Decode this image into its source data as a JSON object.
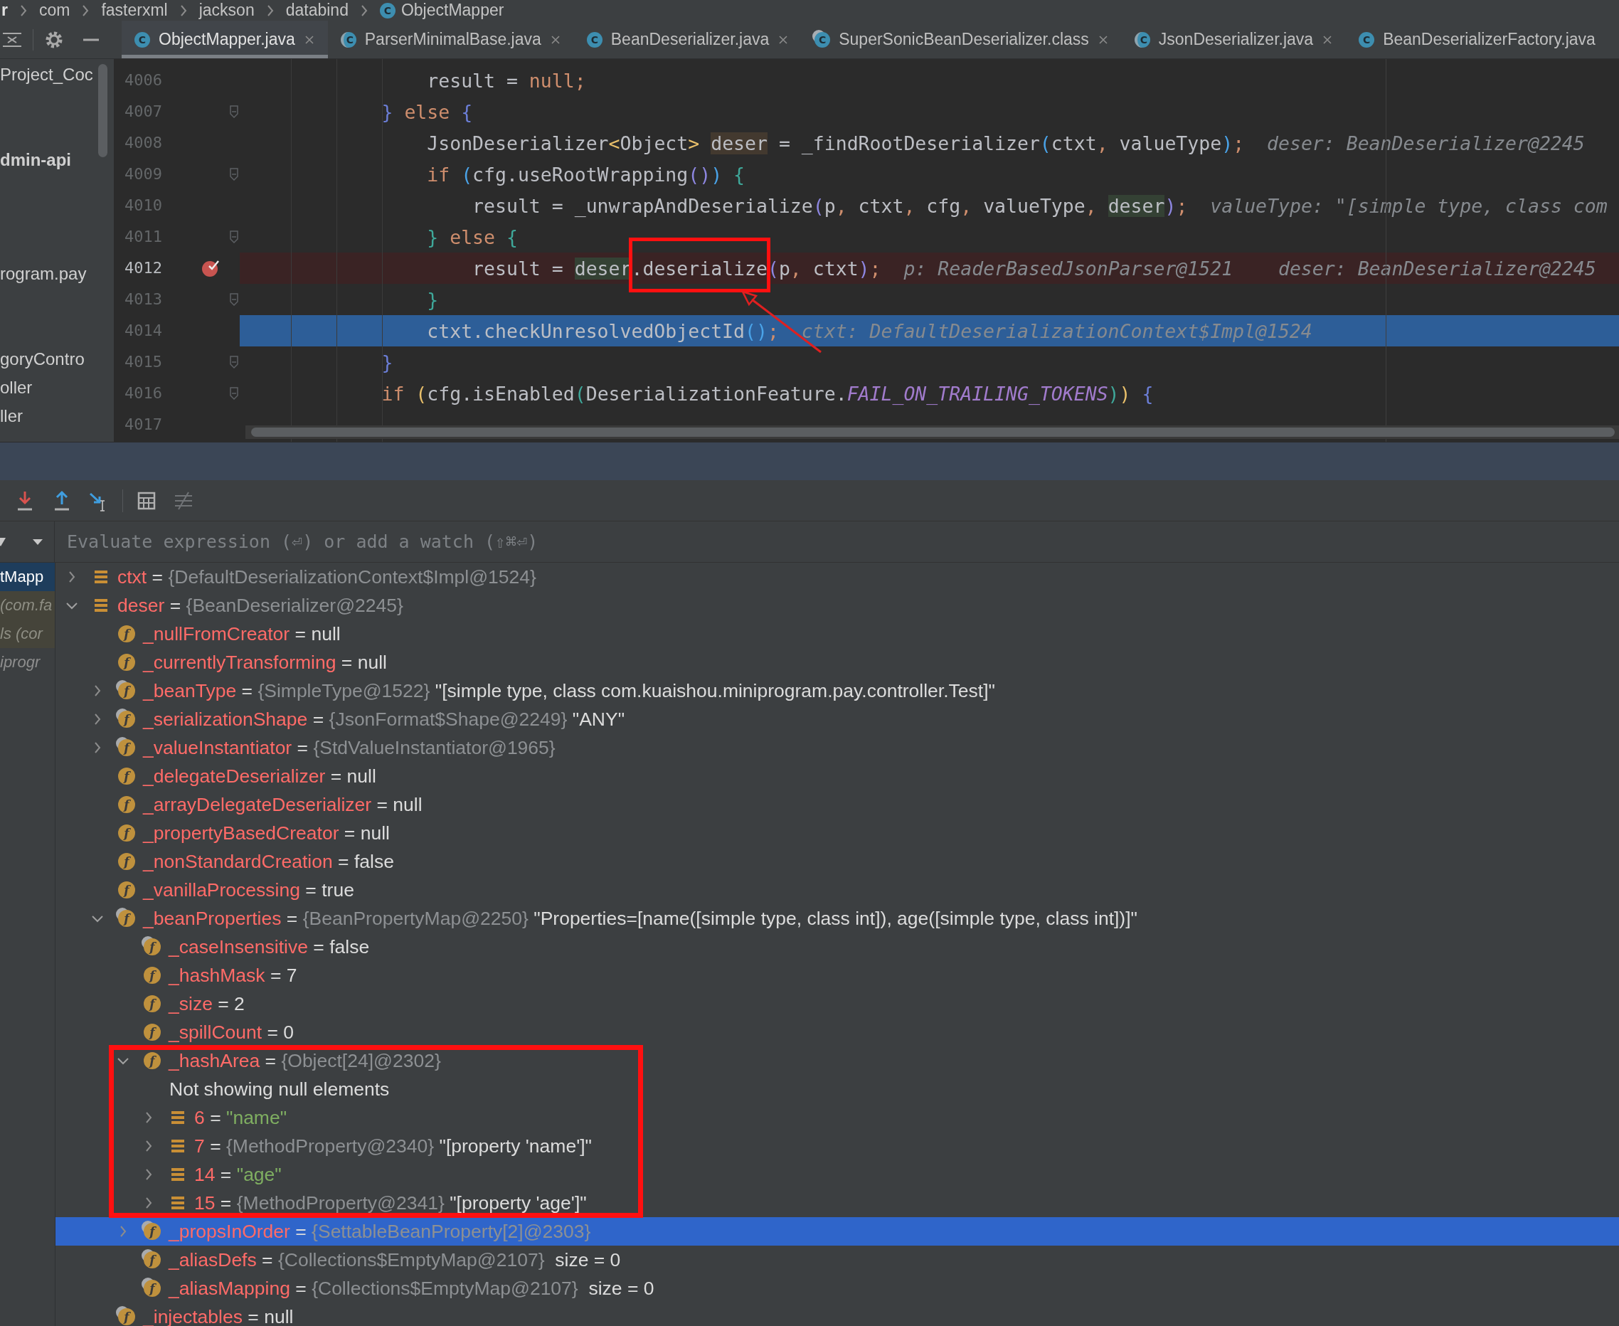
{
  "breadcrumbs": [
    {
      "text": "r"
    },
    {
      "text": "com"
    },
    {
      "text": "fasterxml"
    },
    {
      "text": "jackson"
    },
    {
      "text": "databind"
    },
    {
      "text": "ObjectMapper",
      "badge": "C"
    }
  ],
  "tabs": [
    {
      "label": "ObjectMapper.java",
      "kind": "class",
      "badge": "C",
      "selected": true,
      "closable": true
    },
    {
      "label": "ParserMinimalBase.java",
      "kind": "abstract",
      "badge": "C",
      "selected": false,
      "closable": true
    },
    {
      "label": "BeanDeserializer.java",
      "kind": "class",
      "badge": "C",
      "selected": false,
      "closable": true
    },
    {
      "label": "SuperSonicBeanDeserializer.class",
      "kind": "compiled",
      "badge": "C",
      "selected": false,
      "closable": true
    },
    {
      "label": "JsonDeserializer.java",
      "kind": "abstract",
      "badge": "C",
      "selected": false,
      "closable": true
    },
    {
      "label": "BeanDeserializerFactory.java",
      "kind": "class",
      "badge": "C",
      "selected": false,
      "closable": false
    }
  ],
  "project_panel": {
    "items": [
      {
        "text": "Project_Coc",
        "bold": false
      },
      {
        "text": "dmin-api",
        "bold": true
      },
      {
        "text": "rogram.pay",
        "bold": false
      },
      {
        "text": "goryContro",
        "bold": false
      },
      {
        "text": "oller",
        "bold": false
      },
      {
        "text": "ller",
        "bold": false
      }
    ]
  },
  "editor": {
    "lines": [
      {
        "number": "4006",
        "kind": "normal",
        "fold": false,
        "code": [
          {
            "text": "                result = ",
            "kind": "plain"
          },
          {
            "text": "null",
            "kind": "keyword"
          },
          {
            "text": ";",
            "kind": "keyword"
          }
        ]
      },
      {
        "number": "4007",
        "kind": "normal",
        "fold": true,
        "code": [
          {
            "text": "            }",
            "kind": "brace-blue"
          },
          {
            "text": " else ",
            "kind": "keyword"
          },
          {
            "text": "{",
            "kind": "brace-blue"
          }
        ]
      },
      {
        "number": "4008",
        "kind": "normal",
        "fold": false,
        "code": [
          {
            "text": "                JsonDeserializer",
            "kind": "plain"
          },
          {
            "text": "<",
            "kind": "angle"
          },
          {
            "text": "Object",
            "kind": "plain"
          },
          {
            "text": "> ",
            "kind": "angle"
          },
          {
            "text": "deser",
            "kind": "declaration"
          },
          {
            "text": " = _findRootDeserializer",
            "kind": "plain"
          },
          {
            "text": "(",
            "kind": "paren-blue"
          },
          {
            "text": "ctxt",
            "kind": "plain"
          },
          {
            "text": ", ",
            "kind": "keyword"
          },
          {
            "text": "valueType",
            "kind": "plain"
          },
          {
            "text": ")",
            "kind": "paren-blue"
          },
          {
            "text": ";",
            "kind": "keyword"
          }
        ],
        "hints": [
          "deser: BeanDeserializer@2245"
        ]
      },
      {
        "number": "4009",
        "kind": "normal",
        "fold": true,
        "code": [
          {
            "text": "                if",
            "kind": "keyword"
          },
          {
            "text": " (",
            "kind": "paren-blue"
          },
          {
            "text": "cfg.useRootWrapping",
            "kind": "plain"
          },
          {
            "text": "()",
            "kind": "paren-purple"
          },
          {
            "text": ")",
            "kind": "paren-blue"
          },
          {
            "text": " {",
            "kind": "brace-green"
          }
        ]
      },
      {
        "number": "4010",
        "kind": "normal",
        "fold": false,
        "code": [
          {
            "text": "                    result = _unwrapAndDeserialize",
            "kind": "plain"
          },
          {
            "text": "(",
            "kind": "paren-purple"
          },
          {
            "text": "p",
            "kind": "plain"
          },
          {
            "text": ", ",
            "kind": "keyword"
          },
          {
            "text": "ctxt",
            "kind": "plain"
          },
          {
            "text": ", ",
            "kind": "keyword"
          },
          {
            "text": "cfg",
            "kind": "plain"
          },
          {
            "text": ", ",
            "kind": "keyword"
          },
          {
            "text": "valueType",
            "kind": "plain"
          },
          {
            "text": ", ",
            "kind": "keyword"
          },
          {
            "text": "deser",
            "kind": "usage"
          },
          {
            "text": ")",
            "kind": "paren-purple"
          },
          {
            "text": ";",
            "kind": "keyword"
          }
        ],
        "hints": [
          "valueType: \"[simple type, class com"
        ]
      },
      {
        "number": "4011",
        "kind": "normal",
        "fold": true,
        "code": [
          {
            "text": "                }",
            "kind": "brace-green"
          },
          {
            "text": " else ",
            "kind": "keyword"
          },
          {
            "text": "{",
            "kind": "brace-green"
          }
        ]
      },
      {
        "number": "4012",
        "kind": "breakpoint",
        "fold": false,
        "code": [
          {
            "text": "                    result = ",
            "kind": "plain"
          },
          {
            "text": "deser",
            "kind": "usage"
          },
          {
            "text": ".deserialize",
            "kind": "plain"
          },
          {
            "text": "(",
            "kind": "paren-purple"
          },
          {
            "text": "p",
            "kind": "plain"
          },
          {
            "text": ", ",
            "kind": "keyword"
          },
          {
            "text": "ctxt",
            "kind": "plain"
          },
          {
            "text": ")",
            "kind": "paren-purple"
          },
          {
            "text": ";",
            "kind": "keyword"
          }
        ],
        "hints": [
          "p: ReaderBasedJsonParser@1521",
          "deser: BeanDeserializer@2245"
        ]
      },
      {
        "number": "4013",
        "kind": "normal",
        "fold": true,
        "code": [
          {
            "text": "                }",
            "kind": "brace-green"
          }
        ]
      },
      {
        "number": "4014",
        "kind": "execution",
        "fold": false,
        "code": [
          {
            "text": "                ctxt.checkUnresolvedObjectId",
            "kind": "plain"
          },
          {
            "text": "()",
            "kind": "paren-blue"
          },
          {
            "text": ";",
            "kind": "keyword"
          }
        ],
        "hints": [
          "ctxt: DefaultDeserializationContext$Impl@1524"
        ]
      },
      {
        "number": "4015",
        "kind": "normal",
        "fold": true,
        "code": [
          {
            "text": "            }",
            "kind": "brace-blue"
          }
        ]
      },
      {
        "number": "4016",
        "kind": "normal",
        "fold": true,
        "code": [
          {
            "text": "            if",
            "kind": "keyword"
          },
          {
            "text": " (",
            "kind": "angle"
          },
          {
            "text": "cfg.isEnabled",
            "kind": "plain"
          },
          {
            "text": "(",
            "kind": "brace-green"
          },
          {
            "text": "DeserializationFeature.",
            "kind": "plain"
          },
          {
            "text": "FAIL_ON_TRAILING_TOKENS",
            "kind": "constant"
          },
          {
            "text": ")",
            "kind": "brace-green"
          },
          {
            "text": ")",
            "kind": "angle"
          },
          {
            "text": " {",
            "kind": "brace-blue"
          }
        ]
      },
      {
        "number": "4017",
        "kind": "normal",
        "fold": false
      }
    ]
  },
  "debug": {
    "frames": [
      {
        "text": "tMapp",
        "kind": "app",
        "selected": true
      },
      {
        "text": "(com.fa",
        "kind": "library",
        "selected": false
      },
      {
        "text": "ls (cor",
        "kind": "library",
        "selected": false
      },
      {
        "text": "iprogr",
        "kind": "external",
        "selected": false
      }
    ],
    "evaluate": {
      "placeholder": "Evaluate expression (⏎) or add a watch (⇧⌘⏎)"
    },
    "variables": [
      {
        "kind": "variable",
        "name": "ctxt",
        "sign": "=",
        "ref": "{DefaultDeserializationContext$Impl@1524}",
        "expanded": false,
        "selected": false
      },
      {
        "kind": "variable",
        "name": "deser",
        "sign": "=",
        "ref": "{BeanDeserializer@2245}",
        "expanded": true,
        "selected": false,
        "children": [
          {
            "kind": "field",
            "badge": "f",
            "name": "_nullFromCreator",
            "sign": "=",
            "value": "null",
            "selected": false
          },
          {
            "kind": "field",
            "badge": "f",
            "name": "_currentlyTransforming",
            "sign": "=",
            "value": "null",
            "selected": false
          },
          {
            "kind": "final-field",
            "badge": "f",
            "name": "_beanType",
            "sign": "=",
            "ref": "{SimpleType@1522}",
            "value": "\"[simple type, class com.kuaishou.miniprogram.pay.controller.Test]\"",
            "expanded": false,
            "selected": false
          },
          {
            "kind": "final-field",
            "badge": "f",
            "name": "_serializationShape",
            "sign": "=",
            "ref": "{JsonFormat$Shape@2249}",
            "value": "\"ANY\"",
            "expanded": false,
            "selected": false
          },
          {
            "kind": "final-field",
            "badge": "f",
            "name": "_valueInstantiator",
            "sign": "=",
            "ref": "{StdValueInstantiator@1965}",
            "expanded": false,
            "selected": false
          },
          {
            "kind": "field",
            "badge": "f",
            "name": "_delegateDeserializer",
            "sign": "=",
            "value": "null",
            "selected": false
          },
          {
            "kind": "field",
            "badge": "f",
            "name": "_arrayDelegateDeserializer",
            "sign": "=",
            "value": "null",
            "selected": false
          },
          {
            "kind": "field",
            "badge": "f",
            "name": "_propertyBasedCreator",
            "sign": "=",
            "value": "null",
            "selected": false
          },
          {
            "kind": "field",
            "badge": "f",
            "name": "_nonStandardCreation",
            "sign": "=",
            "value": "false",
            "selected": false
          },
          {
            "kind": "field",
            "badge": "f",
            "name": "_vanillaProcessing",
            "sign": "=",
            "value": "true",
            "selected": false
          },
          {
            "kind": "final-field",
            "badge": "f",
            "name": "_beanProperties",
            "sign": "=",
            "ref": "{BeanPropertyMap@2250}",
            "value": "\"Properties=[name([simple type, class int]), age([simple type, class int])]\"",
            "expanded": true,
            "selected": false,
            "children": [
              {
                "kind": "final-field",
                "badge": "f",
                "name": "_caseInsensitive",
                "sign": "=",
                "value": "false",
                "selected": false
              },
              {
                "kind": "field",
                "badge": "f",
                "name": "_hashMask",
                "sign": "=",
                "value": "7",
                "selected": false
              },
              {
                "kind": "field",
                "badge": "f",
                "name": "_size",
                "sign": "=",
                "value": "2",
                "selected": false
              },
              {
                "kind": "field",
                "badge": "f",
                "name": "_spillCount",
                "sign": "=",
                "value": "0",
                "selected": false
              },
              {
                "kind": "field",
                "badge": "f",
                "name": "_hashArea",
                "sign": "=",
                "ref": "{Object[24]@2302}",
                "expanded": true,
                "selected": false,
                "children": [
                  {
                    "kind": "note",
                    "name": "Not showing null elements",
                    "selected": false
                  },
                  {
                    "kind": "element",
                    "name": "6",
                    "sign": "=",
                    "string": "\"name\"",
                    "expanded": false,
                    "selected": false
                  },
                  {
                    "kind": "element",
                    "name": "7",
                    "sign": "=",
                    "ref": "{MethodProperty@2340}",
                    "value": "\"[property 'name']\"",
                    "expanded": false,
                    "selected": false
                  },
                  {
                    "kind": "element",
                    "name": "14",
                    "sign": "=",
                    "string": "\"age\"",
                    "expanded": false,
                    "selected": false
                  },
                  {
                    "kind": "element",
                    "name": "15",
                    "sign": "=",
                    "ref": "{MethodProperty@2341}",
                    "value": "\"[property 'age']\"",
                    "expanded": false,
                    "selected": false
                  }
                ]
              },
              {
                "kind": "final-field",
                "badge": "f",
                "name": "_propsInOrder",
                "sign": "=",
                "ref": "{SettableBeanProperty[2]@2303}",
                "expanded": false,
                "selected": true
              },
              {
                "kind": "final-field",
                "badge": "f",
                "name": "_aliasDefs",
                "sign": "=",
                "ref": "{Collections$EmptyMap@2107}",
                "extra": "size = 0",
                "selected": false
              },
              {
                "kind": "final-field",
                "badge": "f",
                "name": "_aliasMapping",
                "sign": "=",
                "ref": "{Collections$EmptyMap@2107}",
                "extra": "size = 0",
                "selected": false
              }
            ]
          },
          {
            "kind": "final-field",
            "badge": "f",
            "name": "_injectables",
            "sign": "=",
            "value": "null",
            "selected": false
          }
        ]
      }
    ]
  }
}
